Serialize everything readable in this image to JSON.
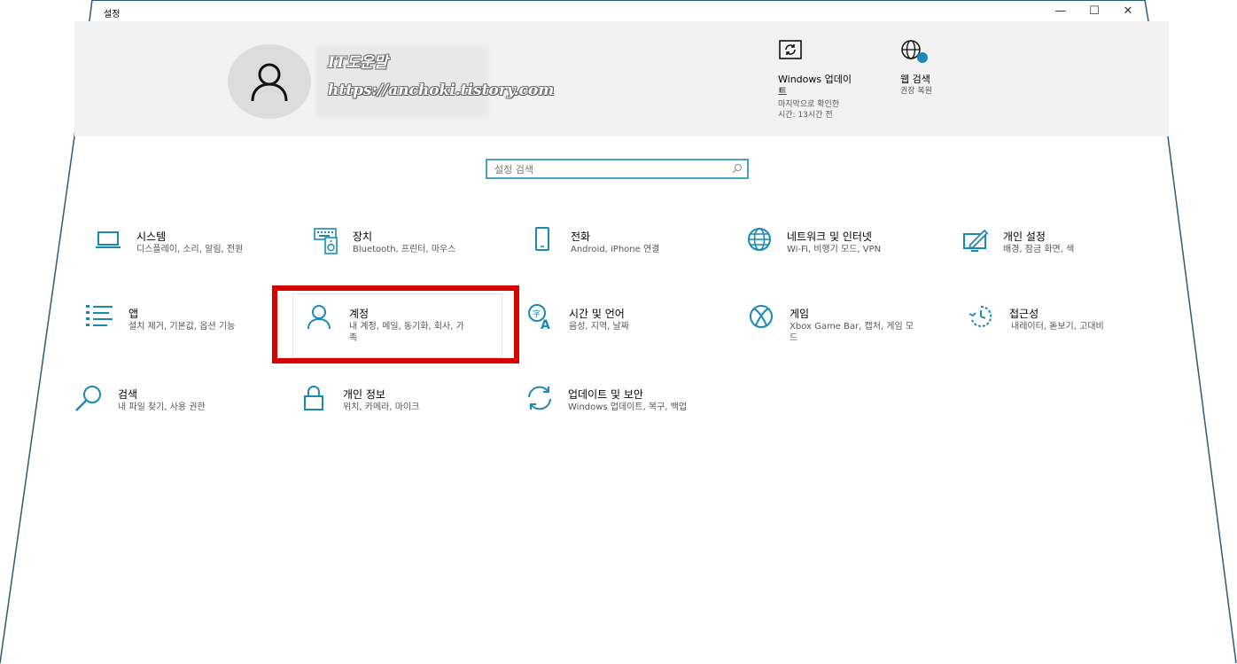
{
  "window": {
    "title": "설정",
    "minimize_symbol": "—",
    "maximize_symbol": "☐",
    "close_symbol": "✕"
  },
  "watermark": {
    "line1": "IT도운말",
    "line2": "https://anchoki.tistory.com"
  },
  "header": {
    "windows_update": {
      "title_line1": "Windows 업데이",
      "title_line2": "트",
      "sub_line1": "마지막으로 확인한",
      "sub_line2": "시간: 13시간 전",
      "icon": "sync-icon"
    },
    "web_search": {
      "title": "웹 검색",
      "sub": "권장 복원",
      "icon": "globe-icon"
    }
  },
  "search": {
    "placeholder": "설정 검색",
    "icon": "search-icon"
  },
  "categories": [
    {
      "id": "system",
      "title": "시스템",
      "desc": "디스플레이, 소리, 알림, 전원",
      "icon": "laptop-icon"
    },
    {
      "id": "devices",
      "title": "장치",
      "desc": "Bluetooth, 프린터, 마우스",
      "icon": "keyboard-speaker-icon"
    },
    {
      "id": "phone",
      "title": "전화",
      "desc": "Android, iPhone 연결",
      "icon": "phone-icon"
    },
    {
      "id": "network",
      "title": "네트워크 및 인터넷",
      "desc": "Wi-Fi, 비행기 모드, VPN",
      "icon": "globe-icon"
    },
    {
      "id": "personalization",
      "title": "개인 설정",
      "desc": "배경, 잠금 화면, 색",
      "icon": "paint-icon"
    },
    {
      "id": "apps",
      "title": "앱",
      "desc": "설치 제거, 기본값, 옵션 기능",
      "icon": "list-icon"
    },
    {
      "id": "accounts",
      "title": "계정",
      "desc_line1": "내 계정, 메일, 동기화, 회사, 가",
      "desc_line2": "족",
      "icon": "person-icon"
    },
    {
      "id": "time_language",
      "title": "시간 및 언어",
      "desc": "음성, 지역, 날짜",
      "icon": "language-icon"
    },
    {
      "id": "gaming",
      "title": "게임",
      "desc_line1": "Xbox Game Bar, 캡처, 게임 모",
      "desc_line2": "드",
      "icon": "xbox-icon"
    },
    {
      "id": "accessibility",
      "title": "접근성",
      "desc": "내레이터, 돋보기, 고대비",
      "icon": "accessibility-timer-icon"
    },
    {
      "id": "search",
      "title": "검색",
      "desc": "내 파일 찾기, 사용 권한",
      "icon": "search-icon"
    },
    {
      "id": "privacy",
      "title": "개인 정보",
      "desc": "위치, 카메라, 마이크",
      "icon": "lock-icon"
    },
    {
      "id": "update_security",
      "title": "업데이트 및 보안",
      "desc": "Windows 업데이트, 복구, 백업",
      "icon": "sync-icon"
    }
  ],
  "colors": {
    "accent": "#1a8ab5",
    "highlight": "#d80000",
    "header_bg": "#f2f2f2",
    "frame": "#2a5a7a"
  }
}
